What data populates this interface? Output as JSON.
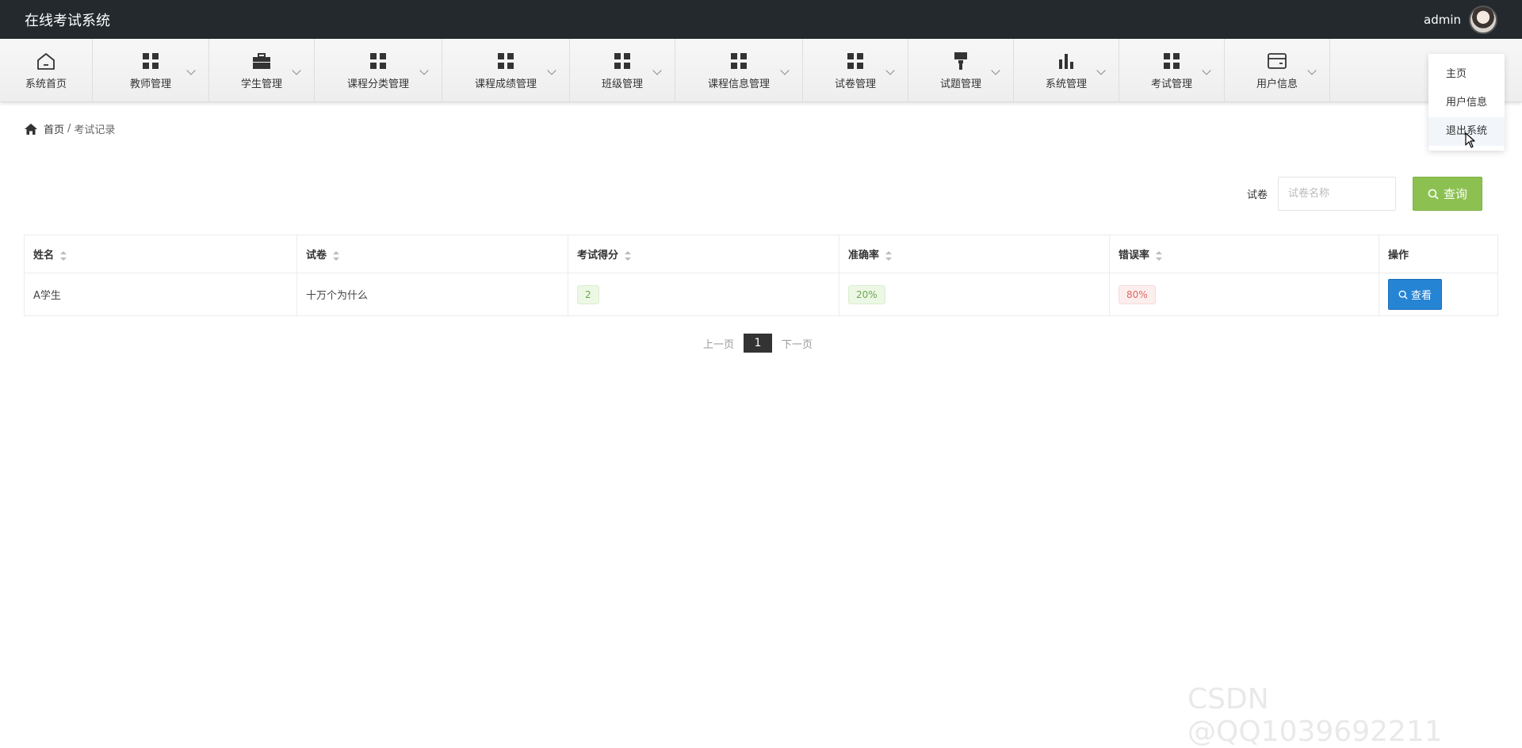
{
  "app": {
    "title": "在线考试系统"
  },
  "user": {
    "name": "admin"
  },
  "nav": [
    {
      "label": "系统首页",
      "icon": "home-icon",
      "caret": false
    },
    {
      "label": "教师管理",
      "icon": "grid-icon",
      "caret": true
    },
    {
      "label": "学生管理",
      "icon": "briefcase-icon",
      "caret": true
    },
    {
      "label": "课程分类管理",
      "icon": "grid-icon",
      "caret": true
    },
    {
      "label": "课程成绩管理",
      "icon": "grid-icon",
      "caret": true
    },
    {
      "label": "班级管理",
      "icon": "grid-icon",
      "caret": true
    },
    {
      "label": "课程信息管理",
      "icon": "grid-icon",
      "caret": true
    },
    {
      "label": "试卷管理",
      "icon": "grid-icon",
      "caret": true
    },
    {
      "label": "试题管理",
      "icon": "paintbrush-icon",
      "caret": true
    },
    {
      "label": "系统管理",
      "icon": "bar-chart-icon",
      "caret": true
    },
    {
      "label": "考试管理",
      "icon": "grid-icon",
      "caret": true
    },
    {
      "label": "用户信息",
      "icon": "card-icon",
      "caret": true
    }
  ],
  "dropdown": {
    "items": [
      "主页",
      "用户信息",
      "退出系统"
    ],
    "hovered": "退出系统"
  },
  "breadcrumb": {
    "home": "首页",
    "separator": "/",
    "current": "考试记录"
  },
  "search": {
    "label": "试卷",
    "placeholder": "试卷名称",
    "button": "查询"
  },
  "table": {
    "headers": [
      "姓名",
      "试卷",
      "考试得分",
      "准确率",
      "错误率",
      "操作"
    ],
    "rows": [
      {
        "name": "A学生",
        "paper": "十万个为什么",
        "score": "2",
        "accuracy": "20%",
        "error_rate": "80%",
        "action": "查看"
      }
    ]
  },
  "pagination": {
    "prev": "上一页",
    "current": "1",
    "next": "下一页"
  },
  "watermark": "CSDN @QQ1039692211",
  "colors": {
    "header_bg": "#23292d",
    "search_button": "#8cc152",
    "view_button": "#2684d4"
  }
}
